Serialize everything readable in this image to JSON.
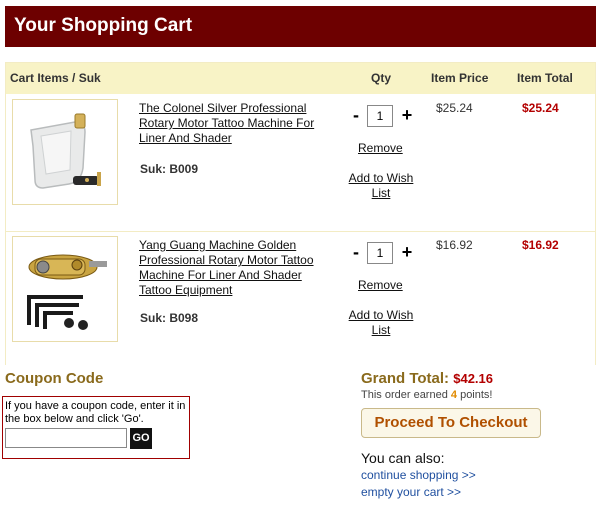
{
  "header": {
    "title": "Your Shopping Cart"
  },
  "table": {
    "col_items": "Cart Items / Suk",
    "col_qty": "Qty",
    "col_price": "Item Price",
    "col_total": "Item Total"
  },
  "items": [
    {
      "name": "The Colonel Silver Professional Rotary Motor Tattoo Machine For Liner And Shader",
      "suk": "Suk: B009",
      "qty": "1",
      "minus": "-",
      "plus": "+",
      "remove": "Remove",
      "wish": "Add to Wish List",
      "price": "$25.24",
      "total": "$25.24",
      "image_icon": "tattoo-machine-silver"
    },
    {
      "name": "Yang Guang Machine Golden Professional Rotary Motor Tattoo Machine For Liner And Shader Tattoo Equipment",
      "suk": "Suk: B098",
      "qty": "1",
      "minus": "-",
      "plus": "+",
      "remove": "Remove",
      "wish": "Add to Wish List",
      "price": "$16.92",
      "total": "$16.92",
      "image_icon": "tattoo-machine-golden"
    }
  ],
  "coupon": {
    "title": "Coupon Code",
    "instructions": "If you have a coupon code, enter it in the box below and click 'Go'.",
    "input_value": "",
    "go_label": "GO"
  },
  "summary": {
    "grand_label": "Grand Total:",
    "grand_value": "$42.16",
    "earned_prefix": "This order earned ",
    "earned_points": "4",
    "earned_suffix": " points!",
    "checkout_label": "Proceed To Checkout",
    "also_label": "You can also:",
    "continue_link": "continue shopping >>",
    "empty_link": "empty your cart >>"
  },
  "colors": {
    "header_bg": "#6d0000",
    "table_header_bg": "#f8f3c6",
    "price_red": "#b30000",
    "accent_gold": "#8a6a1c",
    "link_blue": "#1f4f9f"
  }
}
